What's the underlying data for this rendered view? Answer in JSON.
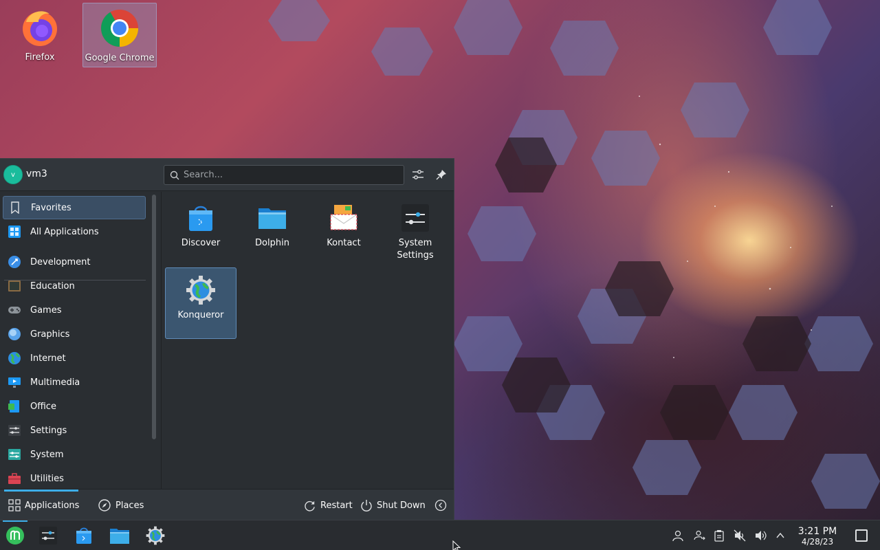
{
  "desktop": {
    "icons": [
      {
        "label": "Firefox",
        "icon": "firefox-icon"
      },
      {
        "label": "Google Chrome",
        "icon": "chrome-icon",
        "selected": true
      }
    ]
  },
  "launcher": {
    "username": "vm3",
    "avatar_letter": "v",
    "search_placeholder": "Search...",
    "sidebar": [
      {
        "label": "Favorites",
        "icon": "bookmark-icon",
        "active": true
      },
      {
        "label": "All Applications",
        "icon": "grid-icon"
      },
      {
        "label": "Development",
        "icon": "development-icon"
      },
      {
        "label": "Education",
        "icon": "education-icon"
      },
      {
        "label": "Games",
        "icon": "gamepad-icon"
      },
      {
        "label": "Graphics",
        "icon": "graphics-icon"
      },
      {
        "label": "Internet",
        "icon": "globe-icon"
      },
      {
        "label": "Multimedia",
        "icon": "multimedia-icon"
      },
      {
        "label": "Office",
        "icon": "office-icon"
      },
      {
        "label": "Settings",
        "icon": "settings-sliders-icon"
      },
      {
        "label": "System",
        "icon": "system-icon"
      },
      {
        "label": "Utilities",
        "icon": "toolbox-icon"
      }
    ],
    "apps": [
      {
        "label": "Discover",
        "icon": "discover-icon"
      },
      {
        "label": "Dolphin",
        "icon": "folder-icon"
      },
      {
        "label": "Kontact",
        "icon": "kontact-icon"
      },
      {
        "label": "System Settings",
        "icon": "system-settings-icon"
      },
      {
        "label": "Konqueror",
        "icon": "konqueror-icon",
        "selected": true
      }
    ],
    "footer": {
      "applications": "Applications",
      "places": "Places",
      "restart": "Restart",
      "shutdown": "Shut Down"
    }
  },
  "panel": {
    "tasks": [
      "application-launcher-icon",
      "system-settings-icon",
      "discover-icon",
      "dolphin-icon",
      "konqueror-icon"
    ],
    "tray": [
      "user-icon",
      "user-switch-icon",
      "clipboard-icon",
      "volume-muted-icon",
      "volume-icon",
      "expand-tray-icon"
    ],
    "clock_time": "3:21 PM",
    "clock_date": "4/28/23"
  },
  "colors": {
    "accent": "#3daee9",
    "panel_bg": "#292c30",
    "launcher_bg": "#2a2e32",
    "selection": "#3b5670"
  }
}
